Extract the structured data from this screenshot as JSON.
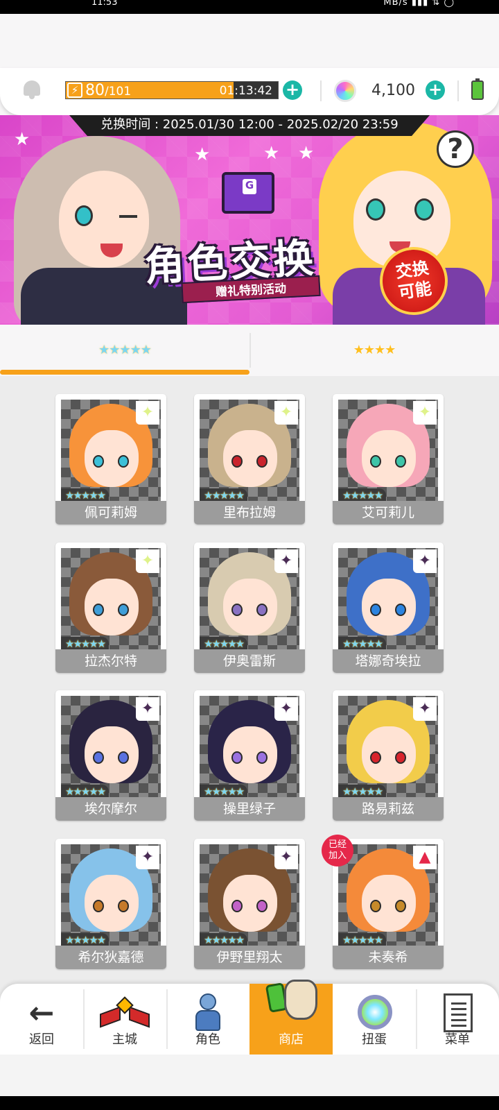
{
  "status_bar": {
    "time": "11:53",
    "right": "MB/s ▮▮▮ ⇅ ◯"
  },
  "resources": {
    "stamina_current": "80",
    "stamina_max": "/101",
    "stamina_fill": 0.79,
    "stamina_timer": "01:13:42",
    "gems": "4,100",
    "stamina_plus": "+",
    "gems_plus": "+"
  },
  "banner": {
    "period": "兑换时间 : 2025.01/30 12:00 - 2025.02/20 23:59",
    "title": "角色交换",
    "subtitle": "赠礼特别活动",
    "badge": "交换可能",
    "help": "?"
  },
  "tabs": [
    {
      "label": "★★★★★",
      "active": true
    },
    {
      "label": "★★★★",
      "active": false
    }
  ],
  "characters": [
    {
      "name": "佩可莉姆",
      "stars": "★★★★★",
      "tag": "✦",
      "hair": "#f7933a",
      "eye": "#3cc0d8"
    },
    {
      "name": "里布拉姆",
      "stars": "★★★★★",
      "tag": "✦",
      "hair": "#c9b28d",
      "eye": "#c9242c"
    },
    {
      "name": "艾可莉儿",
      "stars": "★★★★★",
      "tag": "✦",
      "hair": "#f6a7b8",
      "eye": "#3ec4a8"
    },
    {
      "name": "拉杰尔特",
      "stars": "★★★★★",
      "tag": "✦",
      "hair": "#8a5a3a",
      "eye": "#3f9ed8"
    },
    {
      "name": "伊奥雷斯",
      "stars": "★★★★★",
      "tag": "✦",
      "hair": "#d8cbb0",
      "eye": "#8a72c2"
    },
    {
      "name": "塔娜奇埃拉",
      "stars": "★★★★★",
      "tag": "✦",
      "hair": "#3e70c8",
      "eye": "#2c84e0"
    },
    {
      "name": "埃尔摩尔",
      "stars": "★★★★★",
      "tag": "✦",
      "hair": "#2a2440",
      "eye": "#5a72e0"
    },
    {
      "name": "操里绿子",
      "stars": "★★★★★",
      "tag": "✦",
      "hair": "#2a2448",
      "eye": "#9a72e0"
    },
    {
      "name": "路易莉兹",
      "stars": "★★★★★",
      "tag": "✦",
      "hair": "#f2cc4a",
      "eye": "#d8242c"
    },
    {
      "name": "希尔狄嘉德",
      "stars": "★★★★★",
      "tag": "✦",
      "hair": "#86c2ea",
      "eye": "#c67a2a"
    },
    {
      "name": "伊野里翔太",
      "stars": "★★★★★",
      "tag": "✦",
      "hair": "#7a5232",
      "eye": "#c262c8"
    },
    {
      "name": "未奏希",
      "stars": "★★★★★",
      "tag": "▲",
      "hair": "#f48a3a",
      "eye": "#c68a2a",
      "joined": "已经加入"
    }
  ],
  "nav": {
    "back": "返回",
    "home": "主城",
    "role": "角色",
    "shop": "商店",
    "gacha": "扭蛋",
    "menu": "菜单"
  },
  "colors": {
    "accent": "#f7a11a",
    "teal": "#1bb7a6",
    "name_bar": "#9c9c9c"
  }
}
